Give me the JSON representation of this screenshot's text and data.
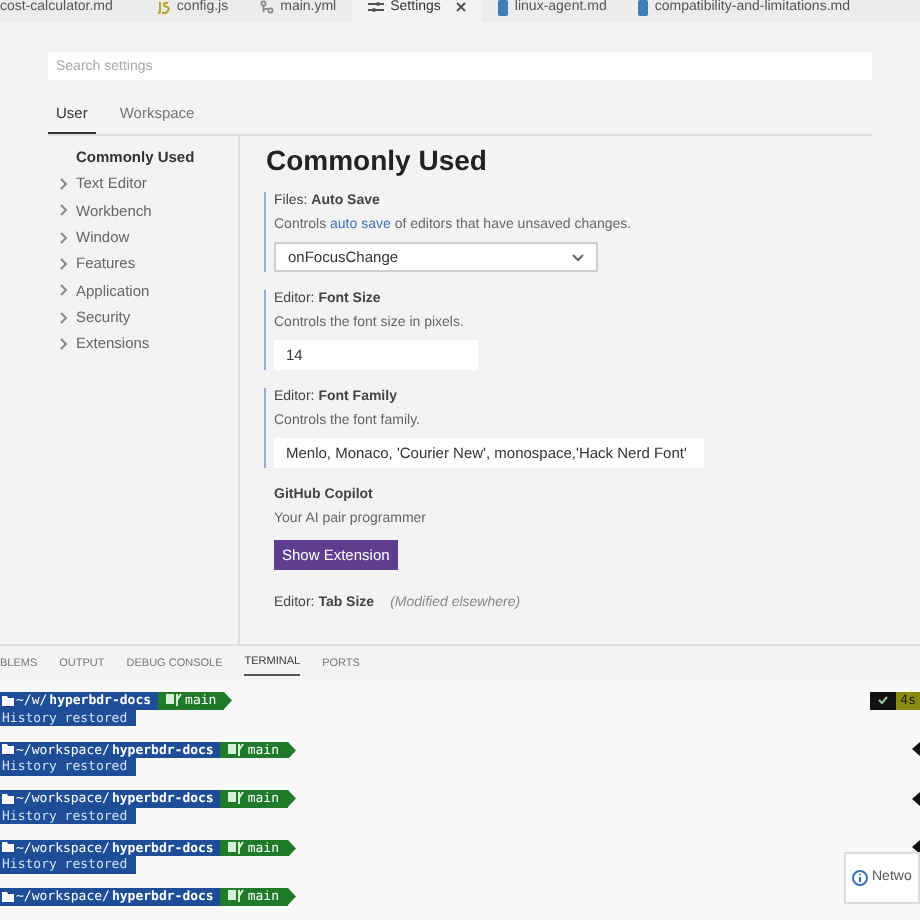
{
  "editor_tabs": [
    {
      "label": "cost-calculator.md",
      "kind": "none",
      "selected": false
    },
    {
      "label": "config.js",
      "kind": "js",
      "selected": false
    },
    {
      "label": "main.yml",
      "kind": "yml",
      "selected": false
    },
    {
      "label": "Settings",
      "kind": "settings",
      "selected": true
    },
    {
      "label": "linux-agent.md",
      "kind": "md",
      "selected": false
    },
    {
      "label": "compatibility-and-limitations.md",
      "kind": "md",
      "selected": false
    }
  ],
  "search": {
    "placeholder": "Search settings"
  },
  "scope_tabs": [
    {
      "label": "User",
      "selected": true
    },
    {
      "label": "Workspace",
      "selected": false
    }
  ],
  "nav": [
    {
      "label": "Commonly Used",
      "selected": true,
      "expandable": false
    },
    {
      "label": "Text Editor",
      "selected": false,
      "expandable": true
    },
    {
      "label": "Workbench",
      "selected": false,
      "expandable": true
    },
    {
      "label": "Window",
      "selected": false,
      "expandable": true
    },
    {
      "label": "Features",
      "selected": false,
      "expandable": true
    },
    {
      "label": "Application",
      "selected": false,
      "expandable": true
    },
    {
      "label": "Security",
      "selected": false,
      "expandable": true
    },
    {
      "label": "Extensions",
      "selected": false,
      "expandable": true
    }
  ],
  "heading": "Commonly Used",
  "settings": [
    {
      "title": "Files: **Auto Save**",
      "modified": true,
      "description": "Controls ",
      "link": "auto save",
      "description_after": " of editors that have unsaved changes.",
      "kind": "select",
      "value": "onFocusChange"
    },
    {
      "title": "Editor: **Font Size**",
      "modified": true,
      "description": "Controls the font size in pixels.",
      "kind": "input",
      "value": "14"
    },
    {
      "title": "Editor: **Font Family**",
      "modified": true,
      "description": "Controls the font family.",
      "kind": "input_wide",
      "value": "Menlo, Monaco, 'Courier New', monospace,'Hack Nerd Font'"
    },
    {
      "title": "**GitHub Copilot**",
      "modified": false,
      "description": "Your AI pair programmer",
      "kind": "button",
      "value": "Show Extension"
    },
    {
      "title": "Editor: **Tab Size**",
      "modified": false,
      "note": "(Modified elsewhere)",
      "kind": "none"
    }
  ],
  "panel_tabs": [
    {
      "label": "BLEMS",
      "selected": false
    },
    {
      "label": "OUTPUT",
      "selected": false
    },
    {
      "label": "DEBUG CONSOLE",
      "selected": false
    },
    {
      "label": "TERMINAL",
      "selected": true
    },
    {
      "label": "PORTS",
      "selected": false
    }
  ],
  "terminal": [
    {
      "path": "~/w/",
      "dir": "hyperbdr-docs",
      "branch": "main",
      "output": "History restored",
      "duration": "4s"
    },
    {
      "path": "~/workspace/",
      "dir": "hyperbdr-docs",
      "branch": "main",
      "output": "History restored"
    },
    {
      "path": "~/workspace/",
      "dir": "hyperbdr-docs",
      "branch": "main",
      "output": "History restored"
    },
    {
      "path": "~/workspace/",
      "dir": "hyperbdr-docs",
      "branch": "main",
      "output": "History restored"
    },
    {
      "path": "~/workspace/",
      "dir": "hyperbdr-docs",
      "branch": "main"
    }
  ],
  "notification": {
    "text": "Netwo"
  }
}
